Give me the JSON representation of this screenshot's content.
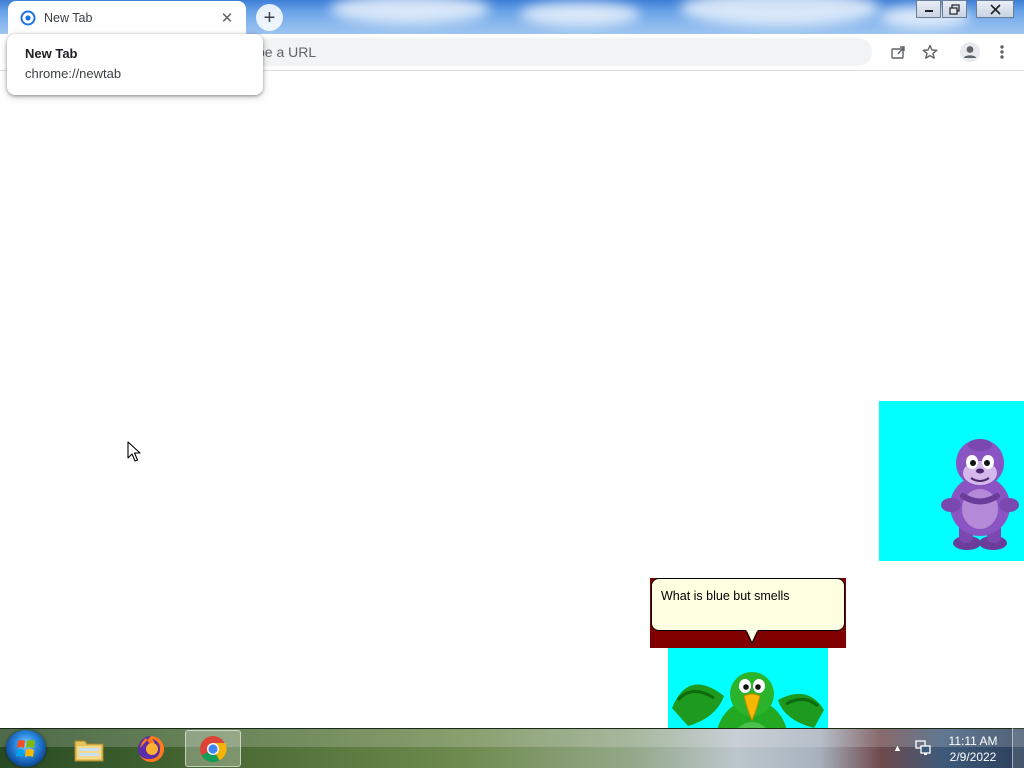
{
  "browser": {
    "tab": {
      "title": "New Tab",
      "close_icon": "close-icon",
      "favicon": "chrome-newtab-icon"
    },
    "new_tab_icon": "plus-icon",
    "window_controls": {
      "minimize": "minimize-icon",
      "restore": "restore-icon",
      "close": "close-icon"
    },
    "omnibox": {
      "placeholder": "pe a URL"
    },
    "toolbar_icons": [
      "share-icon",
      "star-icon",
      "profile-icon",
      "menu-icon"
    ]
  },
  "hover_card": {
    "title": "New Tab",
    "url": "chrome://newtab"
  },
  "agent": {
    "speech_text": "What is blue but smells",
    "panel_color": "#00ffff",
    "speech_bg_color": "#ffffe1",
    "speech_frame_color": "#800000"
  },
  "taskbar": {
    "apps": [
      "file-explorer-icon",
      "firefox-icon",
      "chrome-icon"
    ],
    "active_app": "chrome-icon",
    "clock": {
      "time": "11:11 AM",
      "date": "2/9/2022"
    }
  }
}
